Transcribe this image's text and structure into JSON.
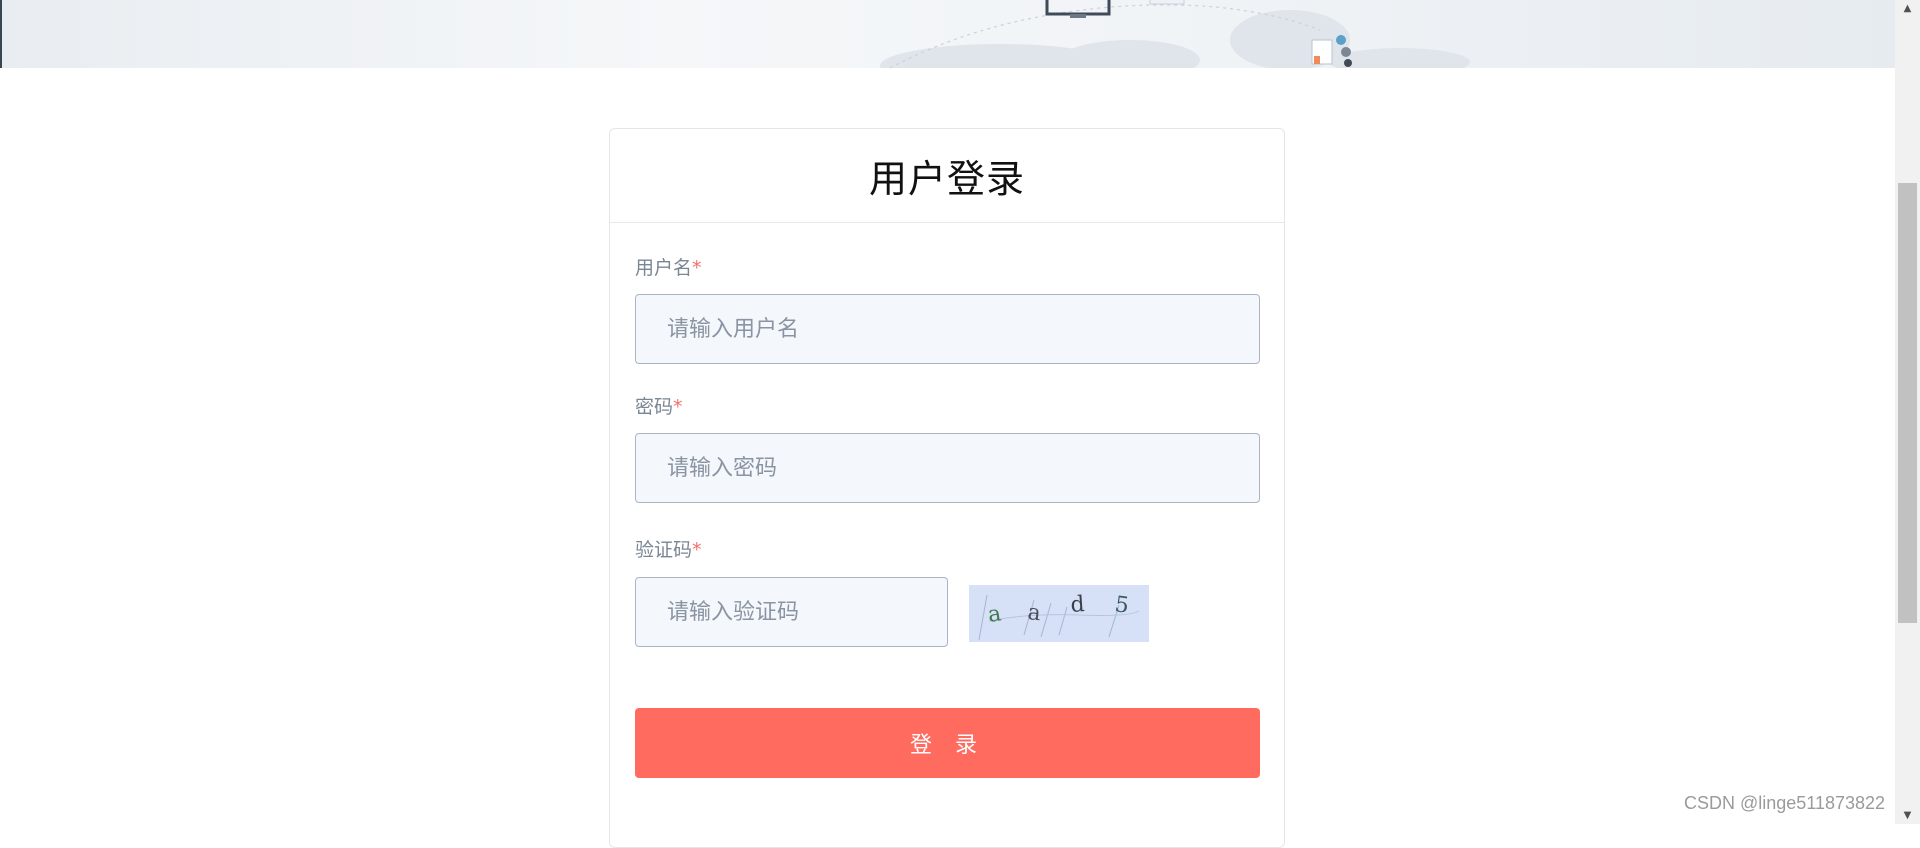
{
  "login": {
    "title": "用户登录",
    "required_mark": "*",
    "username": {
      "label": "用户名",
      "placeholder": "请输入用户名",
      "value": ""
    },
    "password": {
      "label": "密码",
      "placeholder": "请输入密码",
      "value": ""
    },
    "captcha": {
      "label": "验证码",
      "placeholder": "请输入验证码",
      "value": "",
      "image_text": "aad5"
    },
    "submit_label": "登 录"
  },
  "watermark": "CSDN @linge511873822",
  "colors": {
    "accent": "#ff6b5f",
    "required": "#f56c6c",
    "input_bg": "#f4f7fb",
    "captcha_bg": "#d6e1f7"
  }
}
